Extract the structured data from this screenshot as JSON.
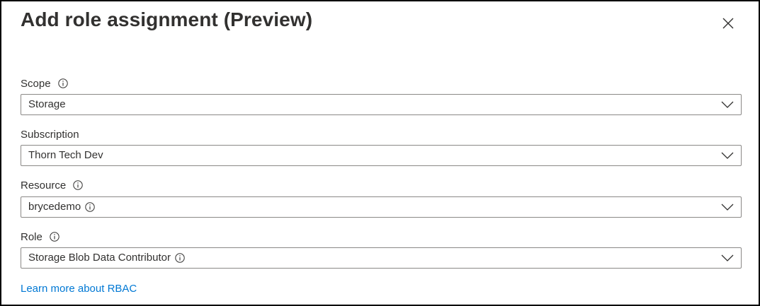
{
  "dialog": {
    "title": "Add role assignment (Preview)",
    "close_icon": "close-icon"
  },
  "fields": {
    "scope": {
      "label": "Scope",
      "value": "Storage",
      "label_info_icon": "info-icon"
    },
    "subscription": {
      "label": "Subscription",
      "value": "Thorn Tech Dev"
    },
    "resource": {
      "label": "Resource",
      "value": "brycedemo",
      "label_info_icon": "info-icon",
      "value_info_icon": "info-icon"
    },
    "role": {
      "label": "Role",
      "value": "Storage Blob Data Contributor",
      "label_info_icon": "info-icon",
      "value_info_icon": "info-icon"
    }
  },
  "footer": {
    "link_label": "Learn more about RBAC"
  },
  "colors": {
    "text": "#323130",
    "border": "#8a8886",
    "link": "#0078d4",
    "frame": "#000000"
  }
}
